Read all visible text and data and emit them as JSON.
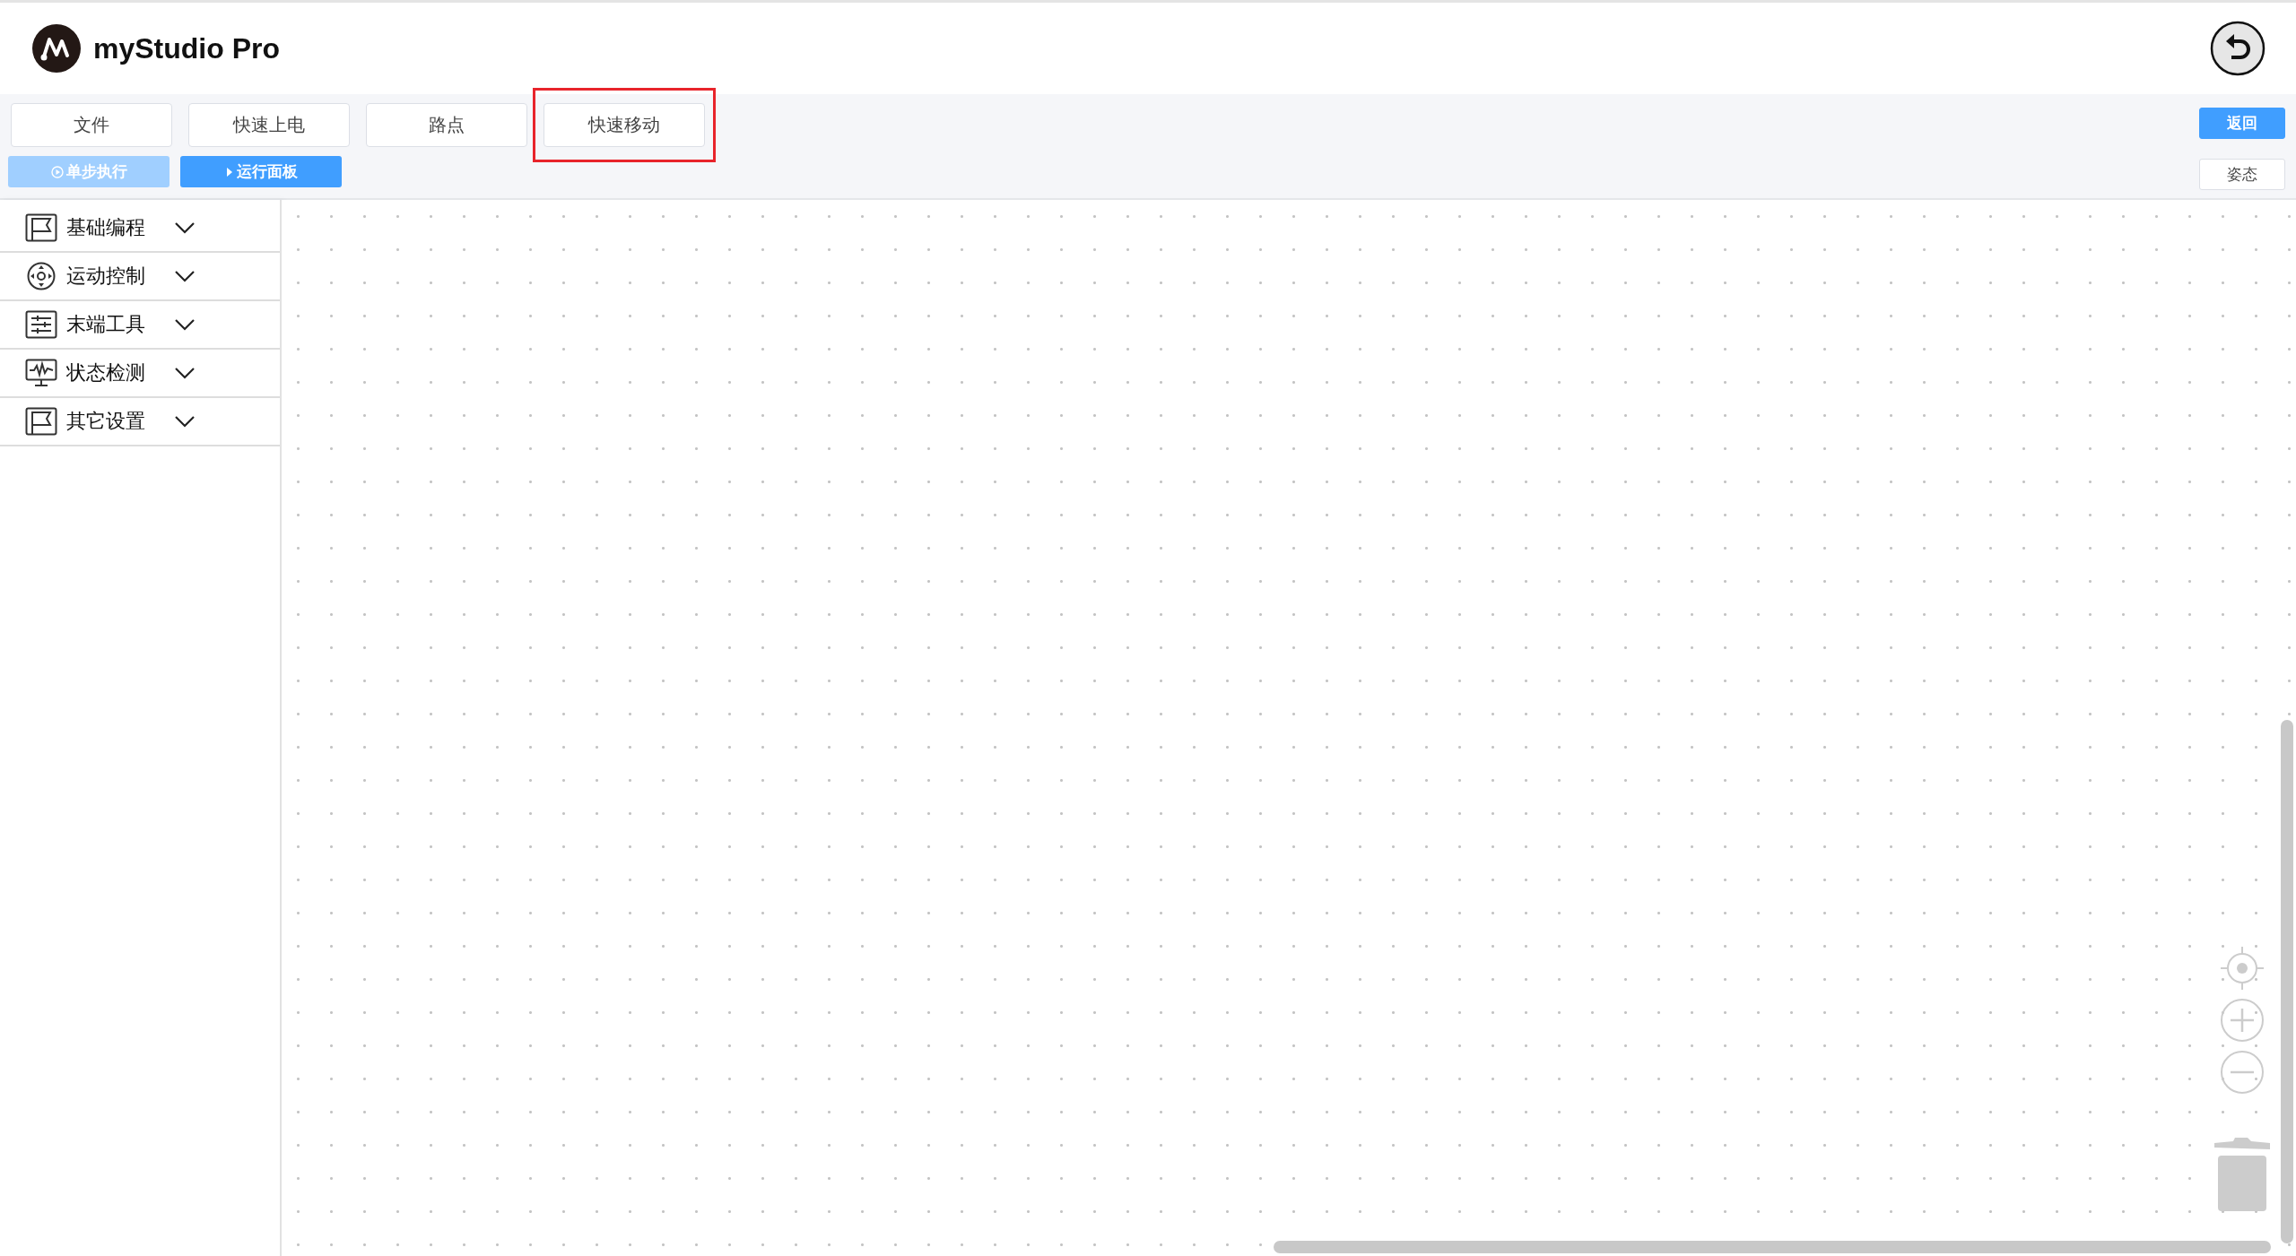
{
  "app": {
    "title": "myStudio Pro"
  },
  "tabs": [
    {
      "label": "文件",
      "highlighted": false
    },
    {
      "label": "快速上电",
      "highlighted": false
    },
    {
      "label": "路点",
      "highlighted": false
    },
    {
      "label": "快速移动",
      "highlighted": true
    }
  ],
  "actions": [
    {
      "label": "单步执行",
      "kind": "step",
      "disabled": true
    },
    {
      "label": "运行面板",
      "kind": "run",
      "disabled": false
    }
  ],
  "right_buttons": [
    {
      "label": "返回",
      "kind": "primary"
    },
    {
      "label": "姿态",
      "kind": "plain"
    }
  ],
  "sidebar": {
    "items": [
      {
        "label": "基础编程",
        "kind": "flag",
        "expanded": false
      },
      {
        "label": "运动控制",
        "kind": "dpad",
        "expanded": false
      },
      {
        "label": "末端工具",
        "kind": "sliders",
        "expanded": false
      },
      {
        "label": "状态检测",
        "kind": "monitor",
        "expanded": false
      },
      {
        "label": "其它设置",
        "kind": "flag",
        "expanded": false
      }
    ]
  }
}
